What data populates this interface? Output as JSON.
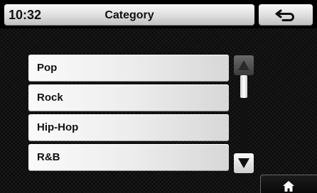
{
  "header": {
    "time": "10:32",
    "title": "Category"
  },
  "buttons": {
    "back_icon": "back-arrow-icon",
    "home_icon": "home-icon"
  },
  "list": {
    "items": [
      {
        "label": "Pop"
      },
      {
        "label": "Rock"
      },
      {
        "label": "Hip-Hop"
      },
      {
        "label": "R&B"
      }
    ]
  },
  "scrollbar": {
    "up_icon": "scroll-up-arrow-icon",
    "down_icon": "scroll-down-arrow-icon",
    "position_fraction": 0.0
  },
  "colors": {
    "background": "#000000",
    "header_light": "#fbfbfb",
    "header_dark": "#bfbfbf",
    "item_light": "#fafafa",
    "item_dark": "#d7d7d7",
    "text": "#111111"
  }
}
